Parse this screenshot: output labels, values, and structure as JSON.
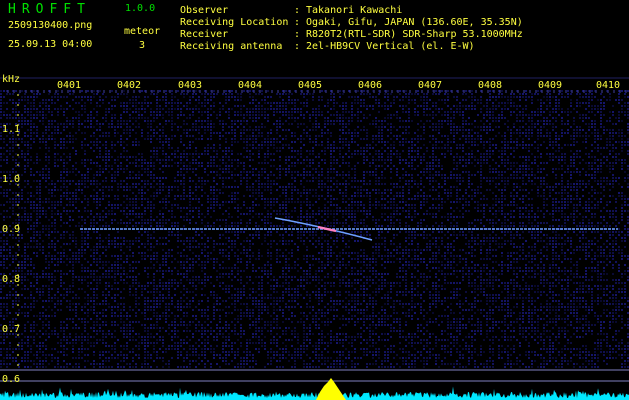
{
  "header": {
    "app_title": "HROFFT",
    "app_version": "1.0.0",
    "filename": "2509130400.png",
    "datetime": "25.09.13 04:00",
    "meteor_label": "meteor",
    "meteor_count": "3"
  },
  "info": {
    "fields": [
      {
        "label": "Observer",
        "value": "Takanori Kawachi"
      },
      {
        "label": "Receiving Location",
        "value": "Ogaki, Gifu, JAPAN (136.60E, 35.35N)"
      },
      {
        "label": "Receiver",
        "value": "R820T2(RTL-SDR) SDR-Sharp 53.1000MHz"
      },
      {
        "label": "Receiving antenna",
        "value": "2el-HB9CV Vertical (el. E-W)"
      }
    ]
  },
  "axes": {
    "y_unit": "kHz",
    "x_ticks": [
      "0401",
      "0402",
      "0403",
      "0404",
      "0405",
      "0406",
      "0407",
      "0408",
      "0409",
      "0410"
    ],
    "y_ticks": [
      "1.1",
      "1.0",
      "0.9",
      "0.8",
      "0.7",
      "0.6"
    ]
  },
  "colors": {
    "text": "#ffff40",
    "title": "#00e000",
    "background": "#000000",
    "carrier": "#6ea0ff",
    "echo": "#ff80c0",
    "spectrum": "#00e8ff",
    "peak": "#ffff00"
  }
}
